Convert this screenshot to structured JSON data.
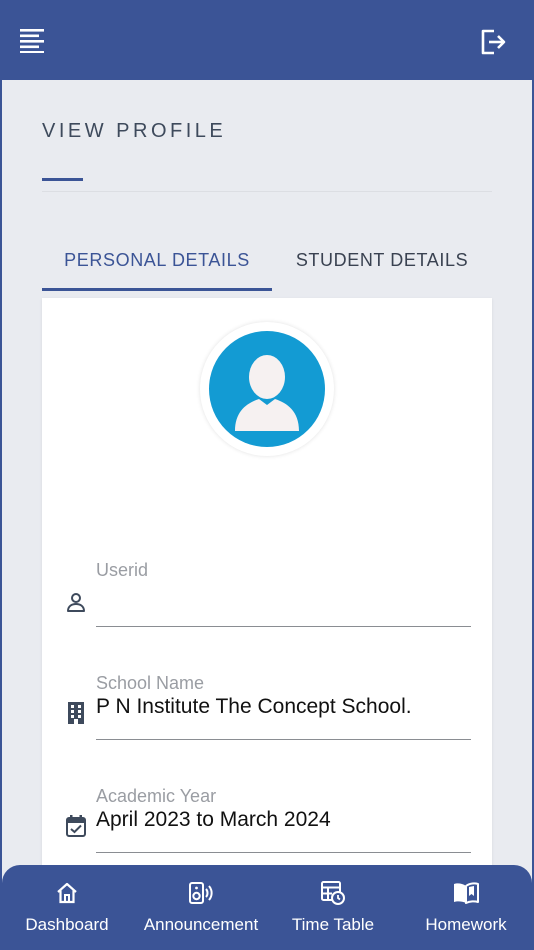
{
  "header": {
    "menu_icon": "menu-lines-icon",
    "logout_icon": "logout-icon"
  },
  "page": {
    "title": "VIEW PROFILE"
  },
  "tabs": [
    {
      "label": "PERSONAL DETAILS",
      "active": true
    },
    {
      "label": "STUDENT DETAILS",
      "active": false
    }
  ],
  "profile": {
    "avatar_icon": "user-silhouette-icon",
    "fields": [
      {
        "label": "Userid",
        "value": "",
        "icon": "person-icon"
      },
      {
        "label": "School Name",
        "value": "P N Institute The Concept School.",
        "icon": "building-icon"
      },
      {
        "label": "Academic Year",
        "value": "April 2023 to March 2024",
        "icon": "calendar-check-icon"
      }
    ]
  },
  "bottom_nav": [
    {
      "label": "Dashboard",
      "icon": "home-icon"
    },
    {
      "label": "Announcement",
      "icon": "speaker-icon"
    },
    {
      "label": "Time Table",
      "icon": "timetable-icon"
    },
    {
      "label": "Homework",
      "icon": "book-icon"
    }
  ],
  "colors": {
    "primary": "#3b5496",
    "background": "#e9ebf0",
    "avatar": "#139bd3",
    "label": "#9a9da3"
  }
}
